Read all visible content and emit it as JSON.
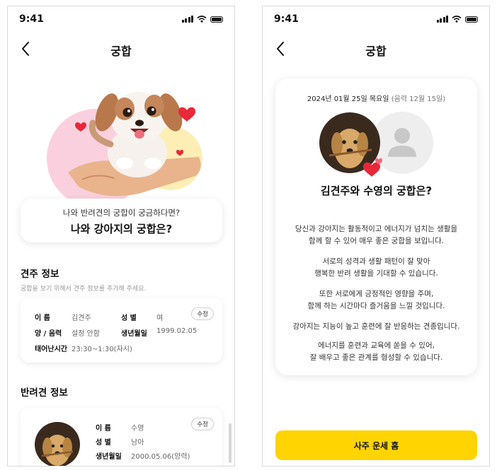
{
  "status_bar": {
    "time": "9:41"
  },
  "screens": [
    {
      "title": "궁합",
      "intro": {
        "question": "나와 반려견의 궁합이 궁금하다면?",
        "headline": "나와 강아지의 궁합은?"
      },
      "owner_section": {
        "title": "견주 정보",
        "subtitle": "궁합을 보기 위해서 견주 정보를 추가해 주세요.",
        "edit_label": "수정",
        "fields": [
          {
            "label": "이    름",
            "value": "김견주"
          },
          {
            "label": "성    별",
            "value": "여"
          },
          {
            "label": "양 / 음력",
            "value": "설정 안함"
          },
          {
            "label": "생년월일",
            "value": "1999.02.05"
          },
          {
            "label": "태어난시간",
            "value": "23:30~1:30(자시)"
          }
        ]
      },
      "pet_section": {
        "title": "반려견 정보",
        "edit_label": "수정",
        "fields": [
          {
            "label": "이    름",
            "value": "수영"
          },
          {
            "label": "성    별",
            "value": "남아"
          },
          {
            "label": "생년월일",
            "value": "2000.05.06(양력)"
          }
        ]
      }
    },
    {
      "title": "궁합",
      "result": {
        "date": "2024년 01월 25일 목요일",
        "lunar": "(음력 12월 15일)",
        "match_title": "김견주와 수영의 궁합은?",
        "paragraphs": [
          [
            "당신과 강아지는 활동적이고 에너지가 넘치는 생활을",
            "함께 할 수 있어 매우 좋은 궁합을 보입니다."
          ],
          [
            "서로의 성격과 생활 패턴이 잘 맞아",
            "행복한 반려 생활을 기대할 수 있습니다."
          ],
          [
            "또한 서로에게 긍정적인 영향을 주며,",
            "함께 하는 시간마다 즐거움을 느낄 것입니다."
          ],
          [
            "강아지는 지능이 높고 훈련에 잘 반응하는 견종입니다."
          ],
          [
            "에너지를 훈련과 교육에 쏟을 수 있어,",
            "잘 배우고 좋은 관계를 형성할 수 있습니다."
          ]
        ]
      },
      "cta_label": "사주 운세 홈"
    }
  ],
  "colors": {
    "accent_yellow": "#ffd400",
    "heart_red": "#e8283a",
    "pink_blob": "#fbd0de",
    "yellow_blob": "#fdeeb5"
  },
  "icons": [
    "back-chevron-icon",
    "cellular-signal-icon",
    "wifi-icon",
    "battery-icon",
    "heart-icon",
    "person-placeholder-icon"
  ]
}
